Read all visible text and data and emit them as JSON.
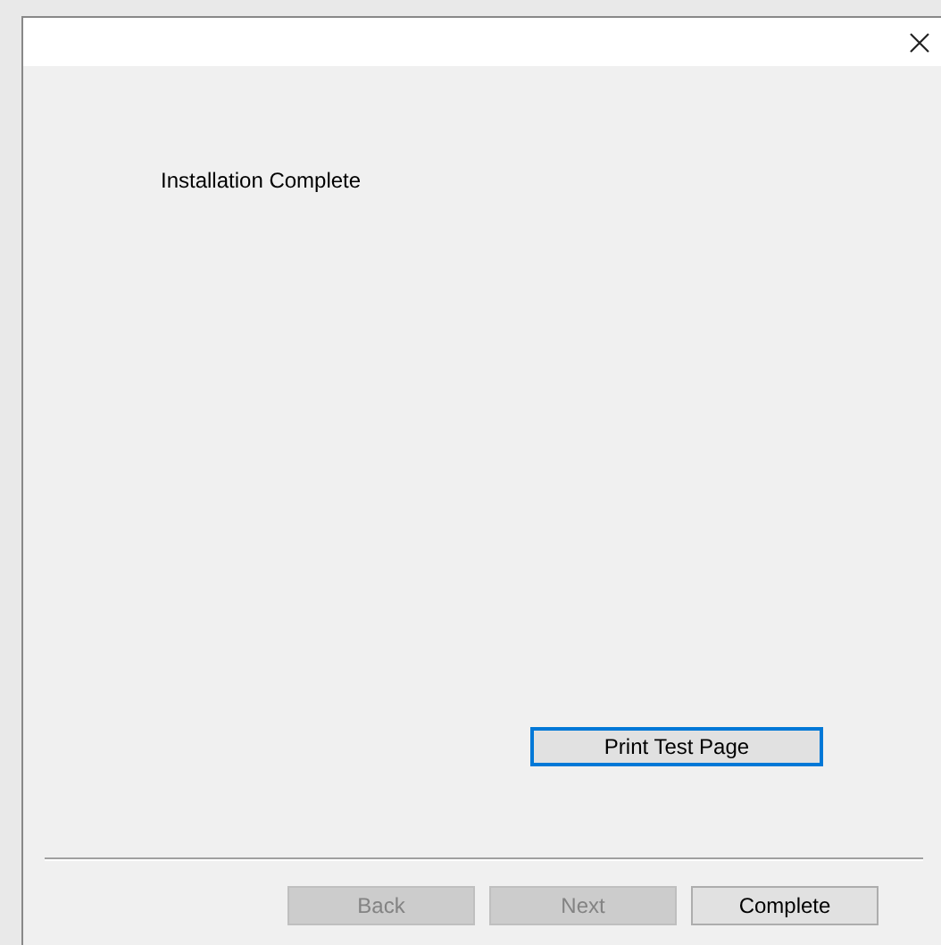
{
  "heading": "Installation Complete",
  "test_button": {
    "label": "Print Test Page",
    "focused": true
  },
  "buttons": [
    {
      "label": "Back",
      "disabled": true
    },
    {
      "label": "Next",
      "disabled": true
    },
    {
      "label": "Complete",
      "disabled": false
    }
  ]
}
